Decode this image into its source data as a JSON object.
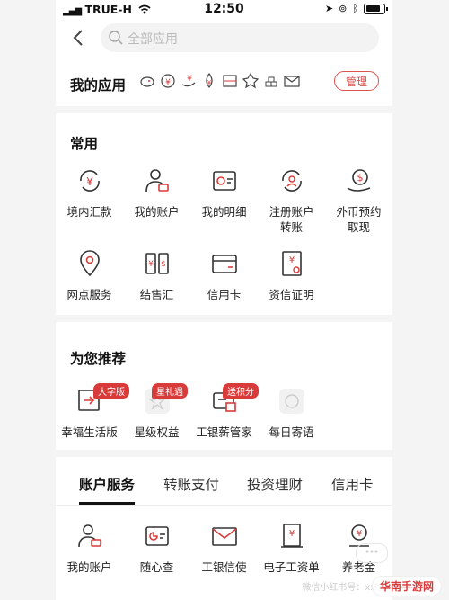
{
  "status": {
    "carrier": "TRUE-H",
    "time": "12:50"
  },
  "search": {
    "placeholder": "全部应用"
  },
  "my_apps": {
    "label": "我的应用",
    "manage_label": "管理"
  },
  "common": {
    "title": "常用",
    "items": [
      {
        "label": "境内汇款",
        "icon": "transfer-yuan-icon"
      },
      {
        "label": "我的账户",
        "icon": "account-person-icon"
      },
      {
        "label": "我的明细",
        "icon": "details-chart-icon"
      },
      {
        "label": "注册账户\n转账",
        "icon": "register-transfer-icon"
      },
      {
        "label": "外币预约\n取现",
        "icon": "foreign-currency-icon"
      },
      {
        "label": "网点服务",
        "icon": "location-pin-icon"
      },
      {
        "label": "结售汇",
        "icon": "exchange-icon"
      },
      {
        "label": "信用卡",
        "icon": "credit-card-icon"
      },
      {
        "label": "资信证明",
        "icon": "credit-certificate-icon"
      }
    ]
  },
  "recommend": {
    "title": "为您推荐",
    "items": [
      {
        "label": "幸福生活版",
        "tag": "大字版",
        "icon": "happy-life-icon"
      },
      {
        "label": "星级权益",
        "tag": "星礼遇",
        "icon": "star-rights-icon"
      },
      {
        "label": "工银薪管家",
        "tag": "送积分",
        "icon": "salary-manager-icon"
      },
      {
        "label": "每日寄语",
        "tag": "",
        "icon": "daily-message-icon"
      }
    ]
  },
  "tabs": [
    "账户服务",
    "转账支付",
    "投资理财",
    "信用卡"
  ],
  "account_services": [
    {
      "label": "我的账户",
      "icon": "account-person-icon"
    },
    {
      "label": "随心查",
      "icon": "query-chart-icon"
    },
    {
      "label": "工银信使",
      "icon": "envelope-icon"
    },
    {
      "label": "电子工资单",
      "icon": "payslip-icon"
    },
    {
      "label": "养老金",
      "icon": "pension-icon"
    }
  ],
  "watermark": "微信小红书号：xxxxx",
  "logo_text": "华南手游网"
}
